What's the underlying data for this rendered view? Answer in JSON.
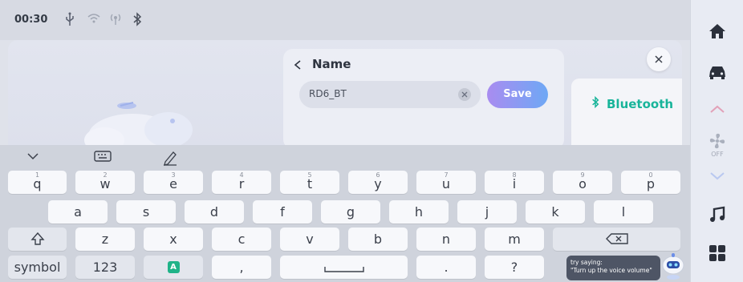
{
  "status": {
    "time": "00:30",
    "icons": [
      "usb-icon",
      "wifi-icon",
      "hotspot-icon",
      "bluetooth-icon"
    ]
  },
  "dock": {
    "icons": [
      "home-icon",
      "car-icon",
      "chevron-up-icon",
      "fan-icon",
      "chevron-down-icon",
      "music-icon",
      "apps-grid-icon"
    ],
    "fan_status": "OFF"
  },
  "name_panel": {
    "title": "Name",
    "input_value": "RD6_BT",
    "save_label": "Save"
  },
  "side_list": {
    "bluetooth_label": "Bluetooth"
  },
  "keyboard": {
    "toolbar_icons": [
      "collapse-icon",
      "keyboard-icon",
      "handwriting-icon"
    ],
    "row1": [
      {
        "letter": "q",
        "num": "1"
      },
      {
        "letter": "w",
        "num": "2"
      },
      {
        "letter": "e",
        "num": "3"
      },
      {
        "letter": "r",
        "num": "4"
      },
      {
        "letter": "t",
        "num": "5"
      },
      {
        "letter": "y",
        "num": "6"
      },
      {
        "letter": "u",
        "num": "7"
      },
      {
        "letter": "i",
        "num": "8"
      },
      {
        "letter": "o",
        "num": "9"
      },
      {
        "letter": "p",
        "num": "0"
      }
    ],
    "row2": [
      "a",
      "s",
      "d",
      "f",
      "g",
      "h",
      "j",
      "k",
      "l"
    ],
    "row3": [
      "z",
      "x",
      "c",
      "v",
      "b",
      "n",
      "m"
    ],
    "symbol_label": "symbol",
    "numbers_label": "123",
    "lang_label": "A",
    "comma_label": ",",
    "period_label": ".",
    "question_label": "?"
  },
  "hint": {
    "line1": "try saying:",
    "line2": "\"Turn up the voice volume\""
  },
  "colors": {
    "accent_green": "#18b49a",
    "save_gradient_start": "#a98cf0",
    "save_gradient_end": "#6ea8f5"
  }
}
